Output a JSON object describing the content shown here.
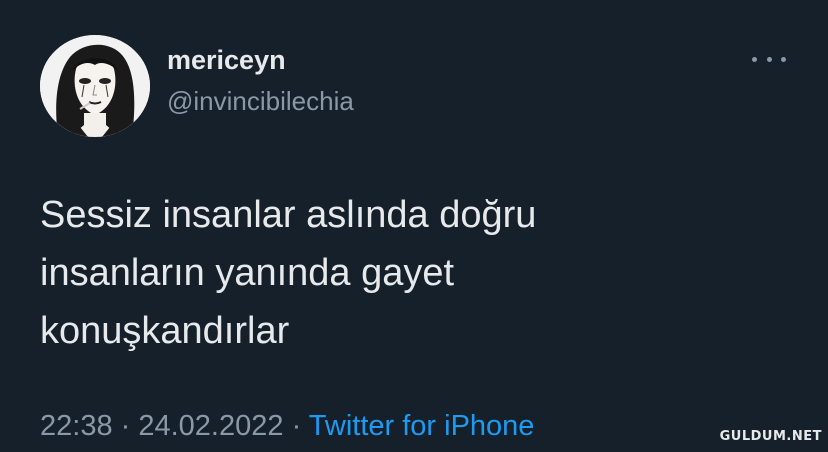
{
  "user": {
    "display_name": "mericeyn",
    "handle": "@invincibilechia",
    "avatar": "avatar-illustration-icon"
  },
  "tweet": {
    "lines": [
      "Sessiz insanlar aslında doğru",
      "insanların yanında gayet",
      "konuşkandırlar"
    ],
    "time": "22:38",
    "date": "24.02.2022",
    "separator": " · ",
    "source": "Twitter for iPhone"
  },
  "more_icon": "more-dots-icon",
  "watermark": "GULDUM.NET",
  "colors": {
    "background": "#15202b",
    "primary_text": "#e7e9ea",
    "secondary_text": "#8b98a5",
    "accent": "#1d9bf0"
  }
}
